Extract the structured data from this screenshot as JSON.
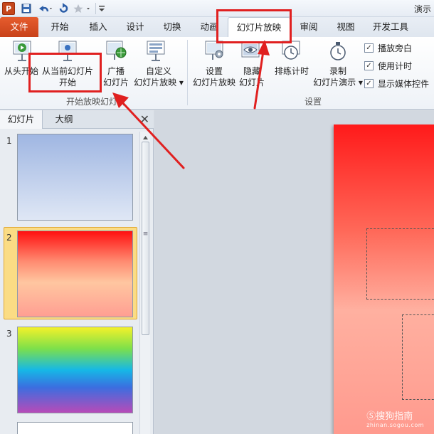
{
  "window": {
    "title": "演示"
  },
  "tabs": [
    {
      "label": "文件"
    },
    {
      "label": "开始"
    },
    {
      "label": "插入"
    },
    {
      "label": "设计"
    },
    {
      "label": "切换"
    },
    {
      "label": "动画"
    },
    {
      "label": "幻灯片放映"
    },
    {
      "label": "审阅"
    },
    {
      "label": "视图"
    },
    {
      "label": "开发工具"
    }
  ],
  "ribbon": {
    "from_start": {
      "line1": "从头开始"
    },
    "from_current": {
      "line1": "从当前幻灯片",
      "line2": "开始"
    },
    "broadcast": {
      "line1": "广播",
      "line2": "幻灯片"
    },
    "custom": {
      "line1": "自定义",
      "line2": "幻灯片放映 ▾"
    },
    "group_start": "开始放映幻灯片",
    "setup": {
      "line1": "设置",
      "line2": "幻灯片放映"
    },
    "hide": {
      "line1": "隐藏",
      "line2": "幻灯片"
    },
    "rehearse": {
      "line1": "排练计时"
    },
    "record": {
      "line1": "录制",
      "line2": "幻灯片演示 ▾"
    },
    "group_setup": "设置",
    "checks": [
      {
        "label": "播放旁白",
        "checked": "✓"
      },
      {
        "label": "使用计时",
        "checked": "✓"
      },
      {
        "label": "显示媒体控件",
        "checked": "✓"
      }
    ]
  },
  "pane": {
    "tab_slides": "幻灯片",
    "tab_outline": "大纲",
    "close": "✕",
    "scroll_mark": "≡",
    "slides": [
      {
        "num": "1"
      },
      {
        "num": "2"
      },
      {
        "num": "3"
      }
    ]
  },
  "watermark": {
    "text": "Ⓢ搜狗指南",
    "sub": "zhinan.sogou.com"
  },
  "colors": {
    "file_tab": "#d24a1f",
    "highlight": "#e02020",
    "selection": "#fbdc84"
  }
}
